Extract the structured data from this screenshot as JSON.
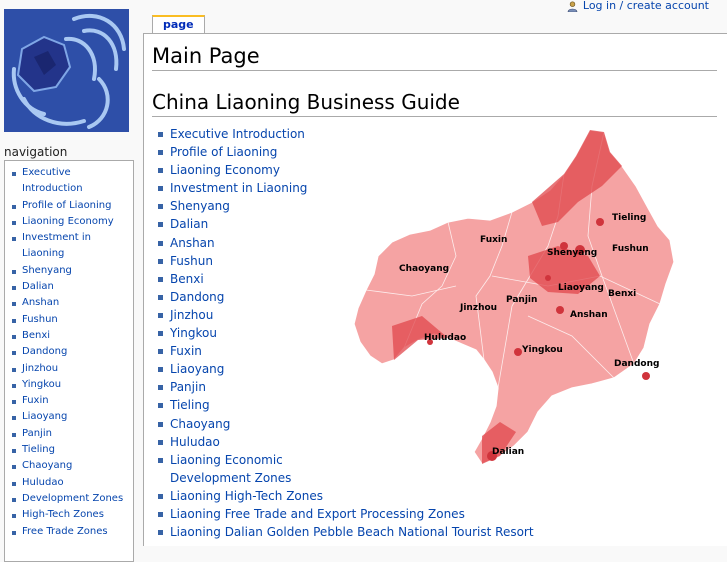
{
  "header": {
    "personal_link": "Log in / create account",
    "tab_page": "page"
  },
  "page": {
    "title": "Main Page",
    "section_heading": "China Liaoning Business Guide"
  },
  "main_links": [
    "Executive Introduction",
    "Profile of Liaoning",
    "Liaoning Economy",
    "Investment in Liaoning",
    "Shenyang",
    "Dalian",
    "Anshan",
    "Fushun",
    "Benxi",
    "Dandong",
    "Jinzhou",
    "Yingkou",
    "Fuxin",
    "Liaoyang",
    "Panjin",
    "Tieling",
    "Chaoyang",
    "Huludao",
    "Liaoning Economic Development Zones",
    "Liaoning High-Tech Zones",
    "Liaoning Free Trade and Export Processing Zones",
    "Liaoning Dalian Golden Pebble Beach National Tourist Resort"
  ],
  "sidebar": {
    "heading": "navigation",
    "items": [
      "Executive Introduction",
      "Profile of Liaoning",
      "Liaoning Economy",
      "Investment in Liaoning",
      "Shenyang",
      "Dalian",
      "Anshan",
      "Fushun",
      "Benxi",
      "Dandong",
      "Jinzhou",
      "Yingkou",
      "Fuxin",
      "Liaoyang",
      "Panjin",
      "Tieling",
      "Chaoyang",
      "Huludao",
      "Development Zones",
      "High-Tech Zones",
      "Free Trade Zones"
    ]
  },
  "map": {
    "labels": [
      "Tieling",
      "Fuxin",
      "Shenyang",
      "Fushun",
      "Chaoyang",
      "Liaoyang",
      "Benxi",
      "Panjin",
      "Jinzhou",
      "Anshan",
      "Huludao",
      "Yingkou",
      "Dandong",
      "Dalian"
    ]
  },
  "icons": {
    "logo": "liaoning-logo",
    "user": "user-icon"
  },
  "colors": {
    "link": "#0645ad",
    "tab_accent": "#fabd23",
    "map_fill": "#f28c8c",
    "map_dark": "#e0474c"
  }
}
